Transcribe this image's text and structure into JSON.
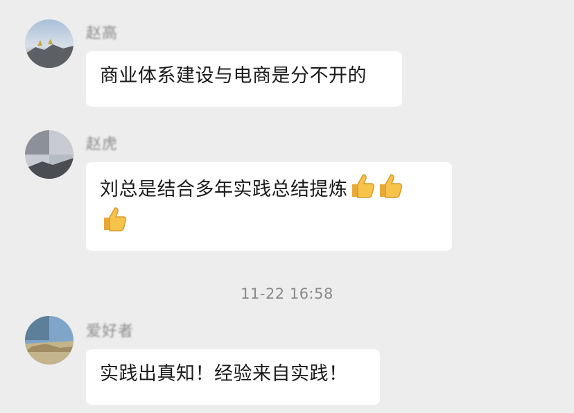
{
  "messages": [
    {
      "sender": "赵高",
      "text": "商业体系建设与电商是分不开的"
    },
    {
      "sender": "赵虎",
      "text": "刘总是结合多年实践总结提炼"
    },
    {
      "sender": "爱好者",
      "text": "实践出真知！经验来自实践！"
    }
  ],
  "timestamp": "11-22 16:58",
  "reaction_icon": "thumbs-up-icon",
  "colors": {
    "background": "#ededed",
    "bubble": "#ffffff",
    "meta_text": "#8a8a8a"
  }
}
